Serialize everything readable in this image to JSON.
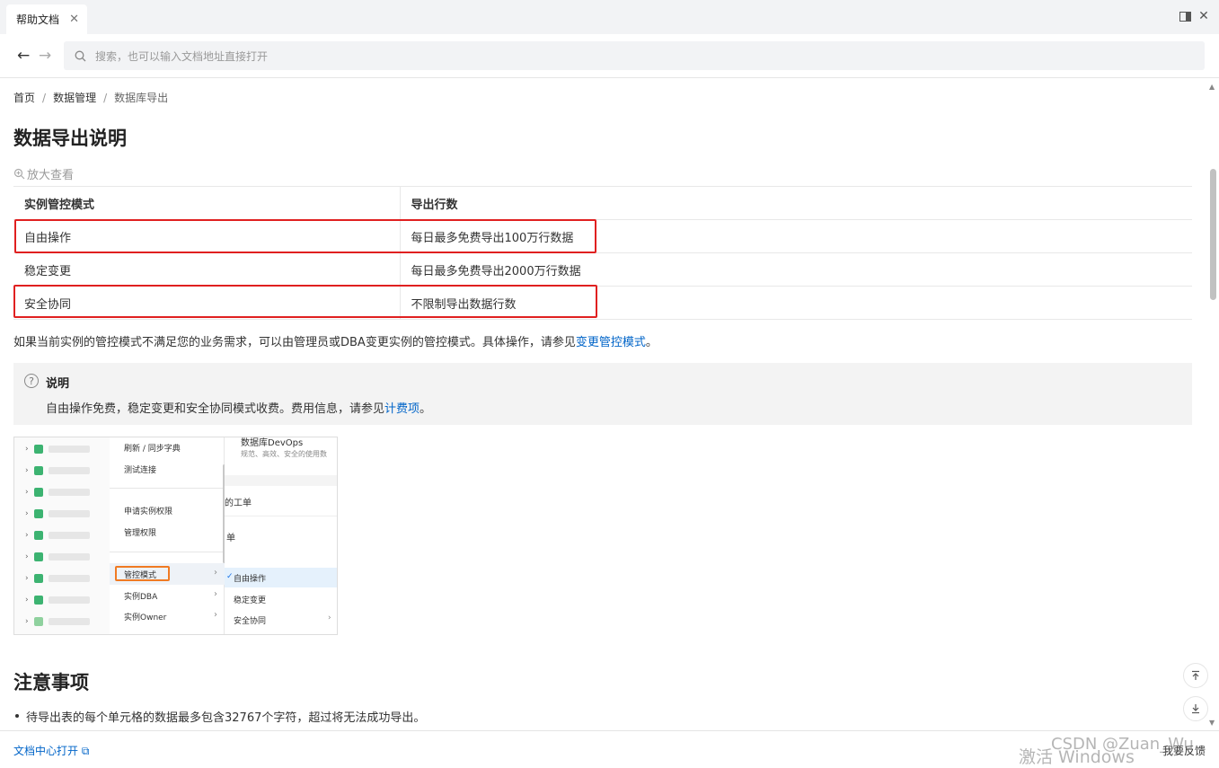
{
  "window": {
    "tab_title": "帮助文档"
  },
  "nav": {
    "search_placeholder": "搜索，也可以输入文档地址直接打开"
  },
  "breadcrumb": [
    "首页",
    "数据管理",
    "数据库导出"
  ],
  "page": {
    "title": "数据导出说明",
    "zoom_label": "放大查看",
    "table": {
      "headers": [
        "实例管控模式",
        "导出行数"
      ],
      "rows": [
        [
          "自由操作",
          "每日最多免费导出100万行数据"
        ],
        [
          "稳定变更",
          "每日最多免费导出2000万行数据"
        ],
        [
          "安全协同",
          "不限制导出数据行数"
        ]
      ]
    },
    "paragraph": {
      "text": "如果当前实例的管控模式不满足您的业务需求，可以由管理员或DBA变更实例的管控模式。具体操作，请参见",
      "link": "变更管控模式",
      "end": "。"
    },
    "note": {
      "title": "说明",
      "text": "自由操作免费，稳定变更和安全协同模式收费。费用信息，请参见",
      "link": "计费项",
      "end": "。"
    },
    "screenshot": {
      "menu_items": [
        "刷新 / 同步字典",
        "测试连接",
        "申请实例权限",
        "管理权限",
        "管控模式",
        "实例DBA",
        "实例Owner"
      ],
      "right_texts": [
        "数据库DevOps",
        "规范、高效、安全的使用数",
        "的工单",
        "单"
      ],
      "submenu": [
        "自由操作",
        "稳定变更",
        "安全协同"
      ]
    },
    "section2_title": "注意事项",
    "bullets": [
      "待导出表的每个单元格的数据最多包含32767个字符，超过将无法成功导出。"
    ]
  },
  "footer": {
    "open_label": "文档中心打开",
    "feedback_label": "我要反馈"
  },
  "watermarks": {
    "windows": "激活 Windows",
    "csdn": "CSDN @Zuan_Wu"
  },
  "colors": {
    "link": "#0064c8",
    "highlight_box": "#e02020",
    "menu_highlight": "#f07a23"
  }
}
